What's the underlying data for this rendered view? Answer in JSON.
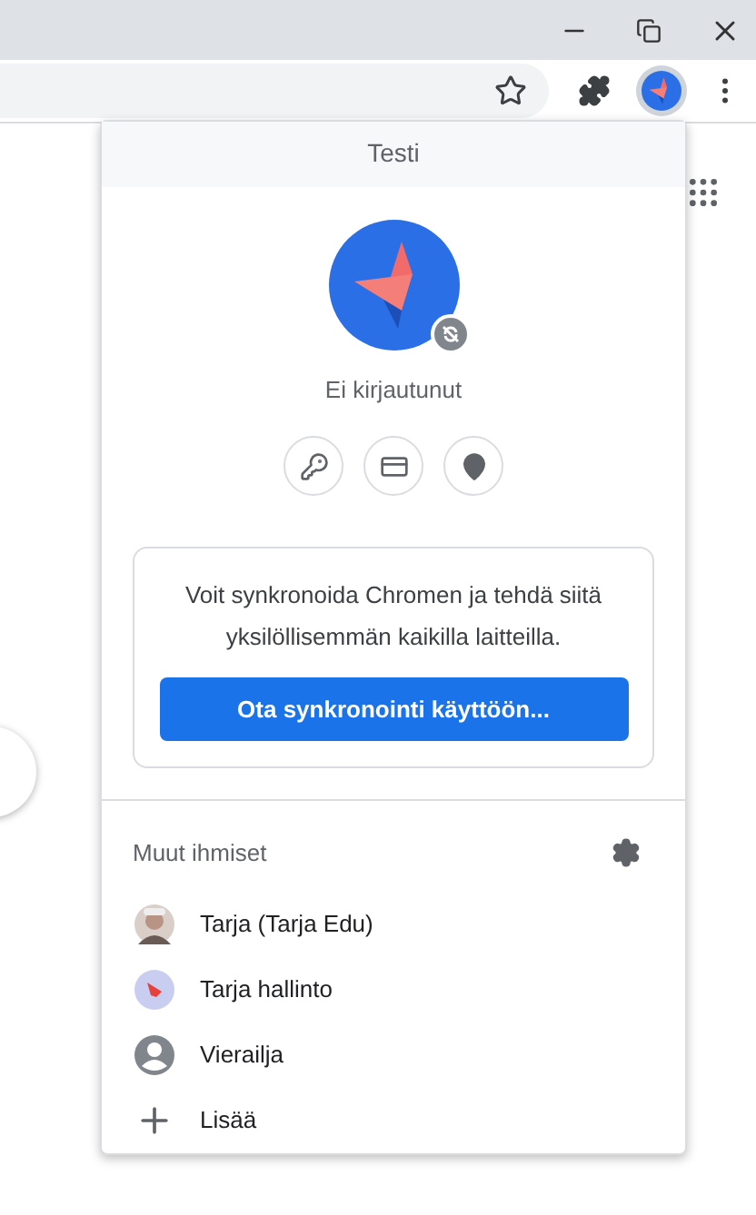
{
  "profile_menu": {
    "title": "Testi",
    "status": "Ei kirjautunut",
    "sync_text": "Voit synkronoida Chromen ja tehdä siitä yksilöllisemmän kaikilla laitteilla.",
    "sync_button": "Ota synkronointi käyttöön...",
    "others_heading": "Muut ihmiset",
    "people": [
      {
        "label": "Tarja (Tarja Edu)"
      },
      {
        "kind": "avatar",
        "label": "Tarja hallinto"
      },
      {
        "kind": "guest",
        "label": "Vierailja"
      },
      {
        "kind": "add",
        "label": "Lisää"
      }
    ]
  }
}
